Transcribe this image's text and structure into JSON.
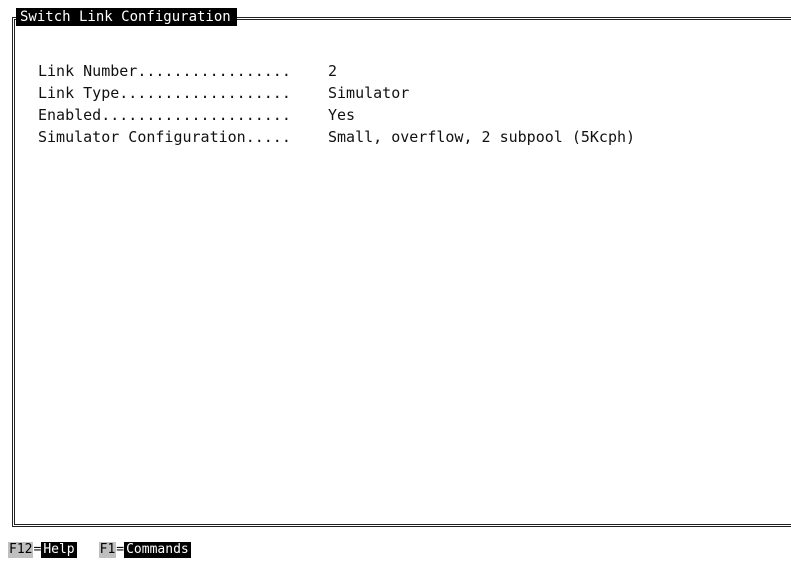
{
  "window": {
    "title": "Switch Link Configuration"
  },
  "fields": [
    {
      "label": "Link Number.................",
      "value": "2"
    },
    {
      "label": "Link Type...................",
      "value": "Simulator"
    },
    {
      "label": "Enabled.....................",
      "value": "Yes"
    },
    {
      "label": "Simulator Configuration.....",
      "value": "Small, overflow, 2 subpool (5Kcph)"
    }
  ],
  "footer": {
    "keys": [
      {
        "key": "F12",
        "sep": "=",
        "label": "Help"
      },
      {
        "key": "F1",
        "sep": "=",
        "label": "Commands"
      }
    ]
  }
}
